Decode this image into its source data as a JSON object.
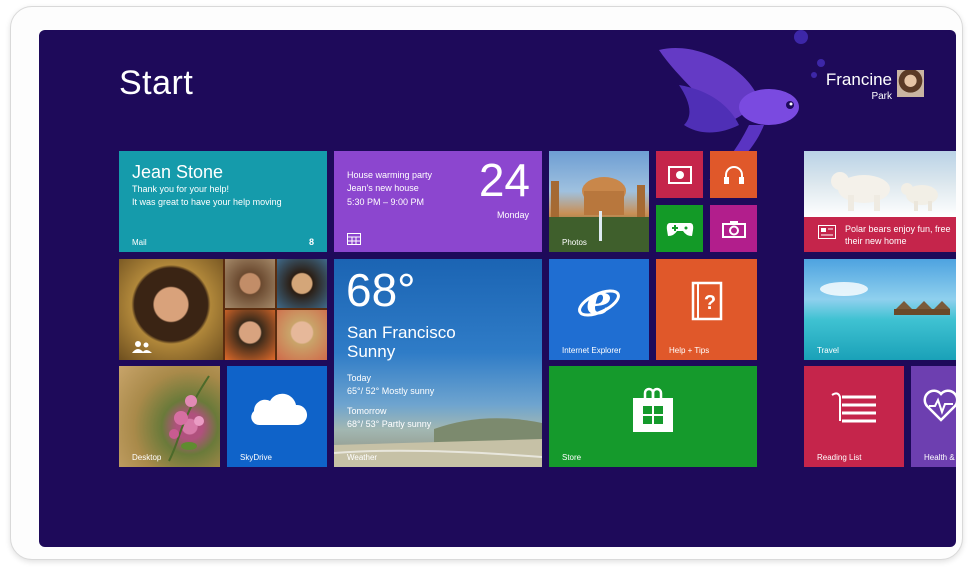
{
  "start_title": "Start",
  "user": {
    "first_name": "Francine",
    "last_name": "Park"
  },
  "tiles": {
    "mail": {
      "label": "Mail",
      "from": "Jean Stone",
      "line1": "Thank you for your help!",
      "line2": "It was great to have your help moving",
      "count": "8"
    },
    "calendar": {
      "event": "House warming party",
      "location": "Jean's new house",
      "time": "5:30 PM – 9:00 PM",
      "day": "24",
      "weekday": "Monday"
    },
    "photos": {
      "label": "Photos"
    },
    "weather": {
      "label": "Weather",
      "temp": "68°",
      "city": "San Francisco",
      "condition": "Sunny",
      "today_label": "Today",
      "today_forecast": "65°/ 52° Mostly sunny",
      "tomorrow_label": "Tomorrow",
      "tomorrow_forecast": "68°/ 53° Partly sunny"
    },
    "internet_explorer": {
      "label": "Internet Explorer"
    },
    "help_tips": {
      "label": "Help + Tips"
    },
    "desktop": {
      "label": "Desktop"
    },
    "skydrive": {
      "label": "SkyDrive"
    },
    "store": {
      "label": "Store"
    },
    "news": {
      "line1": "Polar bears enjoy fun, free",
      "line2": "their new home"
    },
    "travel": {
      "label": "Travel"
    },
    "reading_list": {
      "label": "Reading List"
    },
    "health": {
      "label": "Health &"
    }
  },
  "icons": [
    "video-icon",
    "headphones-icon",
    "xbox-controller-icon",
    "camera-icon",
    "calendar-grid-icon",
    "ie-logo-icon",
    "help-book-icon",
    "store-bag-icon",
    "cloud-icon",
    "reading-list-icon",
    "heartbeat-icon",
    "news-icon",
    "people-icon"
  ],
  "colors": {
    "background": "#1e0a5a",
    "mail": "#159bab",
    "calendar": "#8c46cf",
    "red": "#c5254b",
    "orange": "#e0582a",
    "green": "#139a27",
    "magenta": "#b21e8c",
    "blue": "#1f6ed2"
  }
}
